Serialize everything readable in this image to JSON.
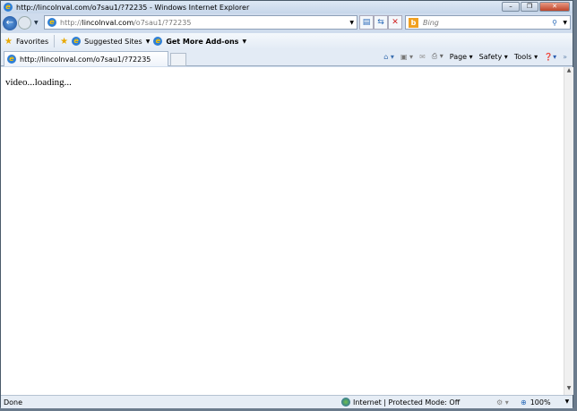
{
  "window": {
    "title": "http://lincolnval.com/o7sau1/?72235 - Windows Internet Explorer"
  },
  "nav": {
    "address_prefix": "http://",
    "address_host": "lincolnval.com",
    "address_path": "/o7sau1/?72235",
    "search_placeholder": "Bing"
  },
  "favorites": {
    "favorites_label": "Favorites",
    "suggested_label": "Suggested Sites",
    "addons_label": "Get More Add-ons"
  },
  "tab": {
    "label": "http://lincolnval.com/o7sau1/?72235"
  },
  "commands": {
    "page": "Page",
    "safety": "Safety",
    "tools": "Tools"
  },
  "content": {
    "text": "video...loading..."
  },
  "status": {
    "left": "Done",
    "zone": "Internet | Protected Mode: Off",
    "zoom": "100%"
  }
}
